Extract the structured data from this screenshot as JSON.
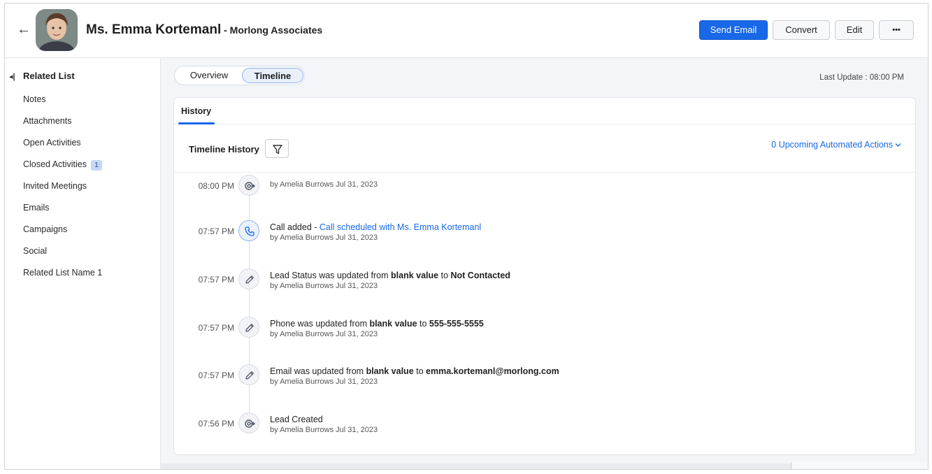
{
  "header": {
    "back_label": "←",
    "name": "Ms. Emma Kortemanl",
    "company": " - Morlong Associates",
    "send_email": "Send Email",
    "convert": "Convert",
    "edit": "Edit",
    "more": "•••"
  },
  "sidebar": {
    "heading": "Related List",
    "items": [
      {
        "label": "Notes",
        "badge": ""
      },
      {
        "label": "Attachments",
        "badge": ""
      },
      {
        "label": "Open Activities",
        "badge": ""
      },
      {
        "label": "Closed Activities",
        "badge": "1"
      },
      {
        "label": "Invited Meetings",
        "badge": ""
      },
      {
        "label": "Emails",
        "badge": ""
      },
      {
        "label": "Campaigns",
        "badge": ""
      },
      {
        "label": "Social",
        "badge": ""
      },
      {
        "label": "Related List Name 1",
        "badge": ""
      }
    ]
  },
  "view_tabs": {
    "overview": "Overview",
    "timeline": "Timeline"
  },
  "last_update": "Last Update : 08:00 PM",
  "card": {
    "tab_history": "History",
    "timeline_history": "Timeline History",
    "upcoming": "0 Upcoming Automated Actions"
  },
  "timeline": [
    {
      "time": "08:00 PM",
      "icon": "target-icon",
      "parts": [],
      "by": "by Amelia Burrows Jul 31, 2023"
    },
    {
      "time": "07:57 PM",
      "icon": "phone-icon",
      "parts": [
        {
          "t": "Call added - ",
          "s": "plain"
        },
        {
          "t": "Call scheduled with Ms. Emma Kortemanl",
          "s": "link"
        }
      ],
      "by": "by Amelia Burrows Jul 31, 2023"
    },
    {
      "time": "07:57 PM",
      "icon": "pencil-icon",
      "parts": [
        {
          "t": "Lead Status was updated from ",
          "s": "plain"
        },
        {
          "t": "blank value",
          "s": "bold"
        },
        {
          "t": " to ",
          "s": "plain"
        },
        {
          "t": "Not Contacted",
          "s": "bold"
        }
      ],
      "by": "by Amelia Burrows Jul 31, 2023"
    },
    {
      "time": "07:57 PM",
      "icon": "pencil-icon",
      "parts": [
        {
          "t": "Phone was updated from ",
          "s": "plain"
        },
        {
          "t": "blank value",
          "s": "bold"
        },
        {
          "t": " to ",
          "s": "plain"
        },
        {
          "t": "555-555-5555",
          "s": "bold"
        }
      ],
      "by": "by Amelia Burrows Jul 31, 2023"
    },
    {
      "time": "07:57 PM",
      "icon": "pencil-icon",
      "parts": [
        {
          "t": "Email was updated from ",
          "s": "plain"
        },
        {
          "t": "blank value",
          "s": "bold"
        },
        {
          "t": " to ",
          "s": "plain"
        },
        {
          "t": "emma.kortemanl@morlong.com",
          "s": "bold"
        }
      ],
      "by": "by Amelia Burrows Jul 31, 2023"
    },
    {
      "time": "07:56 PM",
      "icon": "target-icon",
      "parts": [
        {
          "t": "Lead Created",
          "s": "plain"
        }
      ],
      "by": "by Amelia Burrows Jul 31, 2023"
    }
  ],
  "colors": {
    "accent": "#1868e8",
    "badge_bg": "#c7d7f3"
  }
}
